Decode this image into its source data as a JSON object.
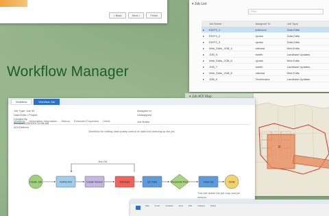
{
  "title": "Workflow Manager",
  "top_left_panel": {
    "buttons": [
      "< Back",
      "Next >",
      "Finish"
    ]
  },
  "job_list": {
    "header": "▾ Job List",
    "filter_placeholder": "Filter",
    "columns": [
      "Job Name",
      "Assigned To",
      "Job Type"
    ],
    "rows": [
      {
        "name": "EDITS_1",
        "assigned": "jrobinson",
        "type": "Data Edits",
        "selected": true
      },
      {
        "name": "EDITS_2",
        "assigned": "cjones",
        "type": "Data Edits",
        "selected": false
      },
      {
        "name": "EDITS_3",
        "assigned": "cjones",
        "type": "Data Edits",
        "selected": false
      },
      {
        "name": "Web_Edits_JOB_4",
        "assigned": "mbrand",
        "type": "Web Edits",
        "selected": false
      },
      {
        "name": "JOB_5",
        "assigned": "rsmith",
        "type": "Landbase Updates",
        "selected": false
      },
      {
        "name": "Web_Edits_JOB_6",
        "assigned": "cjones",
        "type": "Web Edits",
        "selected": false
      },
      {
        "name": "JOB_7",
        "assigned": "rsmith",
        "type": "Landbase Updates",
        "selected": false
      },
      {
        "name": "Web_Edits_JOB_8",
        "assigned": "mbrand",
        "type": "Web Edits",
        "selected": false
      },
      {
        "name": "JOB_9",
        "assigned": "Technicians",
        "type": "Landbase Updates",
        "selected": false
      }
    ]
  },
  "aoi_map": {
    "header": "▾ Job AOI Map"
  },
  "workflow_panel": {
    "tabs": [
      "Workflow",
      "Workflow Job"
    ],
    "info_left": [
      "Job Type: Job 32",
      "Data Edits • Project",
      "Created By",
      "Created 2/20/2019 10:08 AM",
      "AOI Defined"
    ],
    "info_right": [
      "Assigned to",
      "Unassigned",
      "Job Notes"
    ],
    "subtabs": [
      "Workflow",
      "Description Information",
      "History",
      "Extended Properties",
      "Holds"
    ],
    "description": "Workflow for editing data quality control of data and cleaning up the job",
    "steps": [
      {
        "label": "Create Job",
        "color": "#9ed27a"
      },
      {
        "label": "Define AOI",
        "color": "#9ecdee"
      },
      {
        "label": "Create Version",
        "color": "#c5b5e3"
      },
      {
        "label": "Edit Data",
        "color": "#f0625a"
      },
      {
        "label": "QC Data",
        "color": "#5b9be0"
      },
      {
        "label": "Reconcile Post",
        "color": "#a9d47e"
      },
      {
        "label": "Clean Up",
        "color": "#5b9be0"
      },
      {
        "label": "Verify",
        "color": "#f2d36b"
      }
    ],
    "loop_label": "Not OK",
    "note": "This will delete the job map and job version."
  },
  "bottom_panel": {
    "ribbon_items": [
      "Map",
      "Insert",
      "Analysis",
      "View",
      "Edit",
      "Imagery",
      "Share"
    ]
  }
}
